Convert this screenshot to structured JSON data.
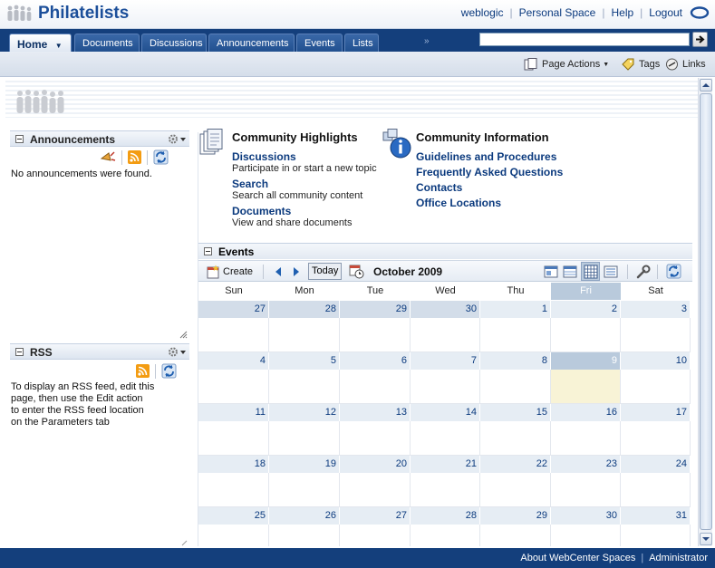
{
  "header": {
    "title": "Philatelists",
    "links": [
      "weblogic",
      "Personal Space",
      "Help",
      "Logout"
    ]
  },
  "tabs": [
    {
      "label": "Home",
      "active": true
    },
    {
      "label": "Documents"
    },
    {
      "label": "Discussions"
    },
    {
      "label": "Announcements"
    },
    {
      "label": "Events"
    },
    {
      "label": "Lists"
    }
  ],
  "tab_overflow": "»",
  "search": {
    "value": "",
    "placeholder": ""
  },
  "page_actions": {
    "page_actions": "Page Actions",
    "tags": "Tags",
    "links": "Links"
  },
  "announcements": {
    "title": "Announcements",
    "empty_message": "No announcements were found."
  },
  "rss": {
    "title": "RSS",
    "message_lines": [
      "To display an RSS feed, edit this",
      "page, then use the Edit action",
      "to enter the RSS feed location",
      "on the Parameters tab"
    ]
  },
  "community_highlights": {
    "title": "Community Highlights",
    "items": [
      {
        "label": "Discussions",
        "desc": "Participate in or start a new topic"
      },
      {
        "label": "Search",
        "desc": "Search all community content"
      },
      {
        "label": "Documents",
        "desc": "View and share documents"
      }
    ]
  },
  "community_information": {
    "title": "Community Information",
    "links": [
      "Guidelines and Procedures",
      "Frequently Asked Questions",
      "Contacts",
      "Office Locations"
    ]
  },
  "events": {
    "title": "Events",
    "create_label": "Create",
    "today_label": "Today",
    "month_label": "October 2009",
    "days_of_week": [
      "Sun",
      "Mon",
      "Tue",
      "Wed",
      "Thu",
      "Fri",
      "Sat"
    ],
    "weeks": [
      [
        "27",
        "28",
        "29",
        "30",
        "1",
        "2",
        "3"
      ],
      [
        "4",
        "5",
        "6",
        "7",
        "8",
        "9",
        "10"
      ],
      [
        "11",
        "12",
        "13",
        "14",
        "15",
        "16",
        "17"
      ],
      [
        "18",
        "19",
        "20",
        "21",
        "22",
        "23",
        "24"
      ],
      [
        "25",
        "26",
        "27",
        "28",
        "29",
        "30",
        "31"
      ]
    ],
    "selected_day": "9"
  },
  "footer": {
    "about": "About WebCenter Spaces",
    "admin": "Administrator"
  },
  "colors": {
    "brand_blue": "#143f7c",
    "link_blue": "#0b3a7e",
    "today_highlight": "#f8f3d6"
  }
}
